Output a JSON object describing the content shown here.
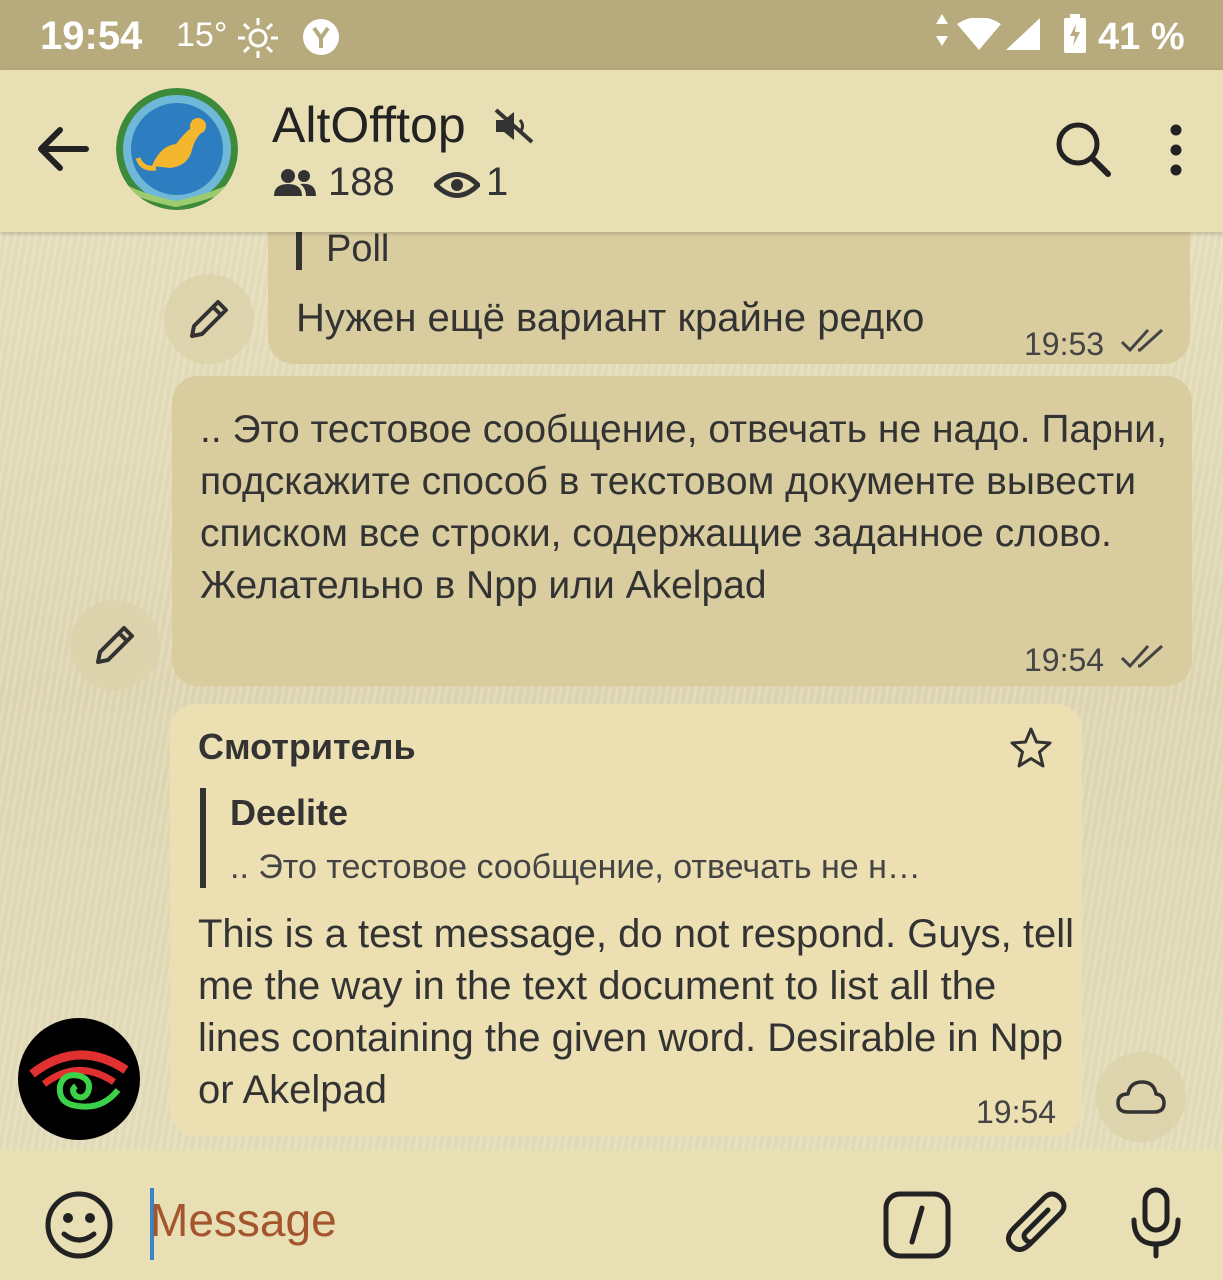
{
  "status_bar": {
    "time": "19:54",
    "temperature": "15°",
    "weather_icon": "sun-icon",
    "battery": "41 %"
  },
  "header": {
    "title": "AltOfftop",
    "members": "188",
    "viewers": "1"
  },
  "messages": [
    {
      "reply_label": "Poll",
      "text": "Нужен ещё вариант крайне редко",
      "time": "19:53",
      "status": "read"
    },
    {
      "text": ".. Это тестовое сообщение, отвечать не надо. Парни, подскажите способ в текстовом документе вывести списком все строки, содержащие заданное слово. Желательно в Npp или Akelpad",
      "time": "19:54",
      "status": "read"
    },
    {
      "sender": "Смотритель",
      "reply_to": {
        "name": "Deelite",
        "text": ".. Это тестовое сообщение, отвечать не н…"
      },
      "text": "This is a test message, do not respond. Guys, tell me the way in the text document to list all the lines containing the given word. Desirable in Npp or Akelpad",
      "time": "19:54"
    }
  ],
  "input": {
    "placeholder": "Message"
  },
  "colors": {
    "accent": "#3b82c4",
    "placeholder": "#a5552d",
    "bubble_out": "#d9cda0",
    "bubble_in": "#ece0b3",
    "status_bar": "#b7aa7c"
  }
}
